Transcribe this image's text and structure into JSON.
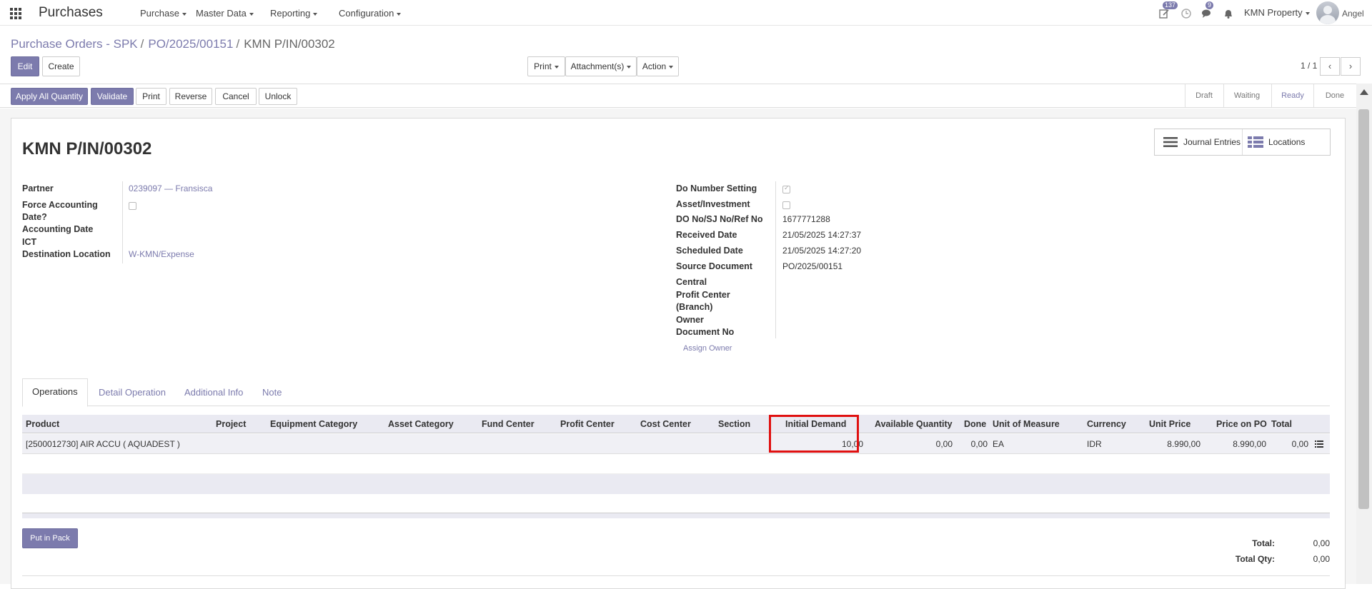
{
  "topbar": {
    "app_title": "Purchases",
    "menus": [
      "Purchase",
      "Master Data",
      "Reporting",
      "Configuration"
    ],
    "activity_badge": "137",
    "messages_badge": "9",
    "company": "KMN Property",
    "user": "Angel"
  },
  "breadcrumb": {
    "items": [
      "Purchase Orders - SPK",
      "PO/2025/00151"
    ],
    "current": "KMN P/IN/00302",
    "separator": "/"
  },
  "control": {
    "edit_label": "Edit",
    "create_label": "Create",
    "print_label": "Print",
    "attachments_label": "Attachment(s)",
    "action_label": "Action",
    "pager": "1 / 1"
  },
  "statusbar": {
    "buttons": [
      "Apply All Quantity",
      "Validate",
      "Print",
      "Reverse",
      "Cancel",
      "Unlock"
    ],
    "stages": [
      "Draft",
      "Waiting",
      "Ready",
      "Done"
    ],
    "active_stage": "Ready"
  },
  "form": {
    "title": "KMN P/IN/00302",
    "smart_buttons": [
      "Journal Entries",
      "Locations"
    ],
    "left": {
      "partner_label": "Partner",
      "partner_value": "0239097 — Fransisca",
      "force_accounting_label_1": "Force Accounting",
      "force_accounting_label_2": "Date?",
      "force_accounting_checked": false,
      "accounting_date_label": "Accounting Date",
      "ict_label": "ICT",
      "destination_label": "Destination Location",
      "destination_value": "W-KMN/Expense"
    },
    "right": {
      "do_number_setting_label": "Do Number Setting",
      "do_number_setting_checked": true,
      "asset_label": "Asset/Investment",
      "asset_checked": false,
      "do_no_label": "DO No/SJ No/Ref No",
      "do_no_value": "1677771288",
      "received_label": "Received Date",
      "received_value": "21/05/2025 14:27:37",
      "scheduled_label": "Scheduled Date",
      "scheduled_value": "21/05/2025 14:27:20",
      "source_label": "Source Document",
      "source_value": "PO/2025/00151",
      "central_label": "Central",
      "profit_center_label_1": "Profit Center",
      "profit_center_label_2": "(Branch)",
      "owner_label": "Owner",
      "document_no_label": "Document No",
      "assign_owner": "Assign Owner"
    }
  },
  "tabs": [
    "Operations",
    "Detail Operation",
    "Additional Info",
    "Note"
  ],
  "table": {
    "headers": [
      "Product",
      "Project",
      "Equipment Category",
      "Asset Category",
      "Fund Center",
      "Profit Center",
      "Cost Center",
      "Section",
      "Initial Demand",
      "Available Quantity",
      "Done",
      "Unit of Measure",
      "Currency",
      "Unit Price",
      "Price on PO",
      "Total"
    ],
    "rows": [
      {
        "product": "[2500012730] AIR ACCU ( AQUADEST )",
        "initial_demand": "10,00",
        "available_quantity": "0,00",
        "done": "0,00",
        "uom": "EA",
        "currency": "IDR",
        "unit_price": "8.990,00",
        "price_on_po": "8.990,00",
        "total": "0,00"
      }
    ]
  },
  "footer": {
    "put_in_pack": "Put in Pack",
    "total_label": "Total:",
    "total_value": "0,00",
    "total_qty_label": "Total Qty:",
    "total_qty_value": "0,00"
  },
  "colors": {
    "accent": "#7c7bad",
    "highlight_box": "#e01010"
  }
}
